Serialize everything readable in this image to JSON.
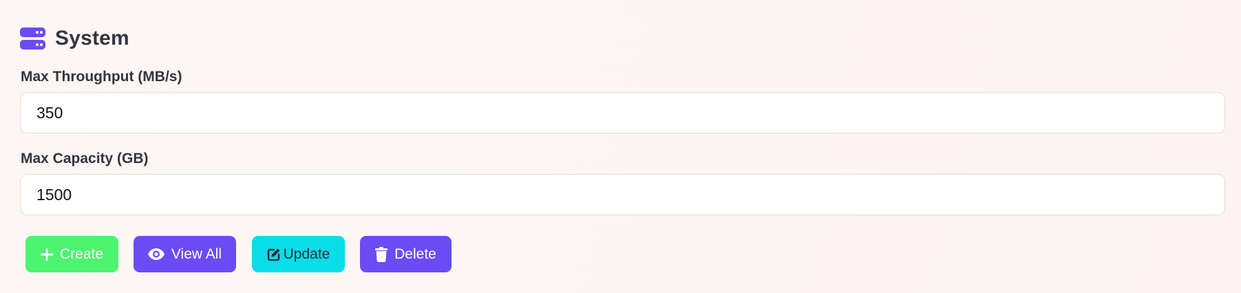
{
  "section": {
    "title": "System",
    "icon": "server-icon"
  },
  "fields": [
    {
      "label": "Max Throughput (MB/s)",
      "value": "350"
    },
    {
      "label": "Max Capacity (GB)",
      "value": "1500"
    }
  ],
  "actions": {
    "create_label": "Create",
    "view_all_label": "View All",
    "update_label": "Update",
    "delete_label": "Delete"
  },
  "colors": {
    "accent": "#6a4cf4",
    "create": "#4cf46f",
    "update": "#09dde8",
    "delete": "#6a4cf4"
  }
}
